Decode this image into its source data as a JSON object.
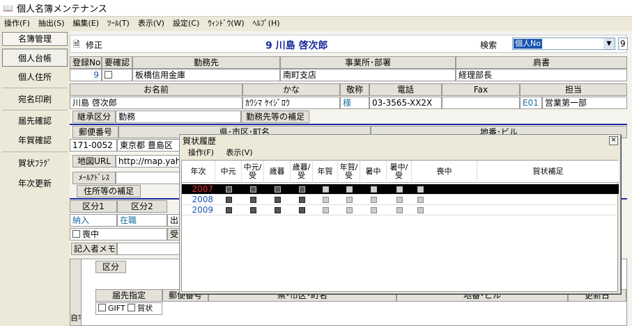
{
  "window": {
    "title": "個人名簿メンテナンス",
    "icon": "book-icon"
  },
  "menubar": [
    "操作(F)",
    "抽出(S)",
    "編集(E)",
    "ﾂｰﾙ(T)",
    "表示(V)",
    "設定(C)",
    "ｳｨﾝﾄﾞｳ(W)",
    "ﾍﾙﾌﾟ(H)"
  ],
  "sidebar": {
    "header": "名簿管理",
    "items": [
      "個人台帳",
      "個人住所",
      "宛名印刷",
      "届先確認",
      "年賀確認",
      "賀状ﾌﾗｸﾞ",
      "年次更新"
    ]
  },
  "modebar": {
    "mode": "修正",
    "record_title": "9 川島 啓次郎",
    "search_label": "検索",
    "search_value": "個人No",
    "search_input": "9"
  },
  "row1": {
    "headers": [
      "登録No",
      "要確認",
      "勤務先",
      "事業所･部署",
      "肩書"
    ],
    "reg_no": "9",
    "company": "板橋信用金庫",
    "office": "南町支店",
    "position": "経理部長"
  },
  "row2": {
    "headers": [
      "お名前",
      "かな",
      "敬称",
      "電話",
      "Fax",
      "担当"
    ],
    "name": "川島 啓次郎",
    "kana": "ｶﾜｼﾏ ｹｲｼﾞﾛｳ",
    "honorific": "様",
    "phone": "03-3565-XX2X",
    "fax": "",
    "staff_code": "E01",
    "staff_name": "営業第一部"
  },
  "row3": {
    "label": "継承区分",
    "value": "勤務",
    "supplement": "勤務先等の補足"
  },
  "row4": {
    "headers": [
      "郵便番号",
      "県･市区･町名",
      "地番･ビル"
    ],
    "zip": "171-0052",
    "address": "東京都 豊島区"
  },
  "row5": {
    "map_label": "地図URL",
    "map_value": "http://map.yah",
    "mail_label": "ﾒｰﾙｱﾄﾞﾚｽ",
    "addr_supp": "住所等の補足"
  },
  "row6": {
    "headers": [
      "区分1",
      "区分2"
    ],
    "k1": "納入",
    "k2": "在職",
    "mourning": "喪中",
    "partial": "出",
    "partial2": "受"
  },
  "row7": {
    "label": "記入者メモ"
  },
  "bottom": {
    "headers": [
      "区分",
      "届先指定",
      "郵便番号",
      "県･市区･町名",
      "地番･ビル",
      "更新日"
    ],
    "gift": "GIFT",
    "nenga": "賀状",
    "side": "自宅"
  },
  "dialog": {
    "title": "賀状履歴",
    "menu": [
      "操作(F)",
      "表示(V)"
    ],
    "columns": [
      "年次",
      "中元",
      "中元/受",
      "歳暮",
      "歳暮/受",
      "年賀",
      "年賀/受",
      "暑中",
      "暑中/受",
      "喪中",
      "賀状補足"
    ],
    "rows": [
      {
        "year": "2007",
        "marks": [
          1,
          1,
          1,
          1,
          0,
          0,
          0,
          0,
          0
        ],
        "selected": true
      },
      {
        "year": "2008",
        "marks": [
          1,
          1,
          1,
          1,
          0,
          0,
          0,
          0,
          0
        ],
        "selected": false
      },
      {
        "year": "2009",
        "marks": [
          1,
          1,
          1,
          1,
          0,
          0,
          0,
          0,
          0
        ],
        "selected": false
      }
    ]
  },
  "colors": {
    "accent": "#1a2b9a",
    "link": "#1a55b0",
    "selected_year": "#f03030"
  }
}
